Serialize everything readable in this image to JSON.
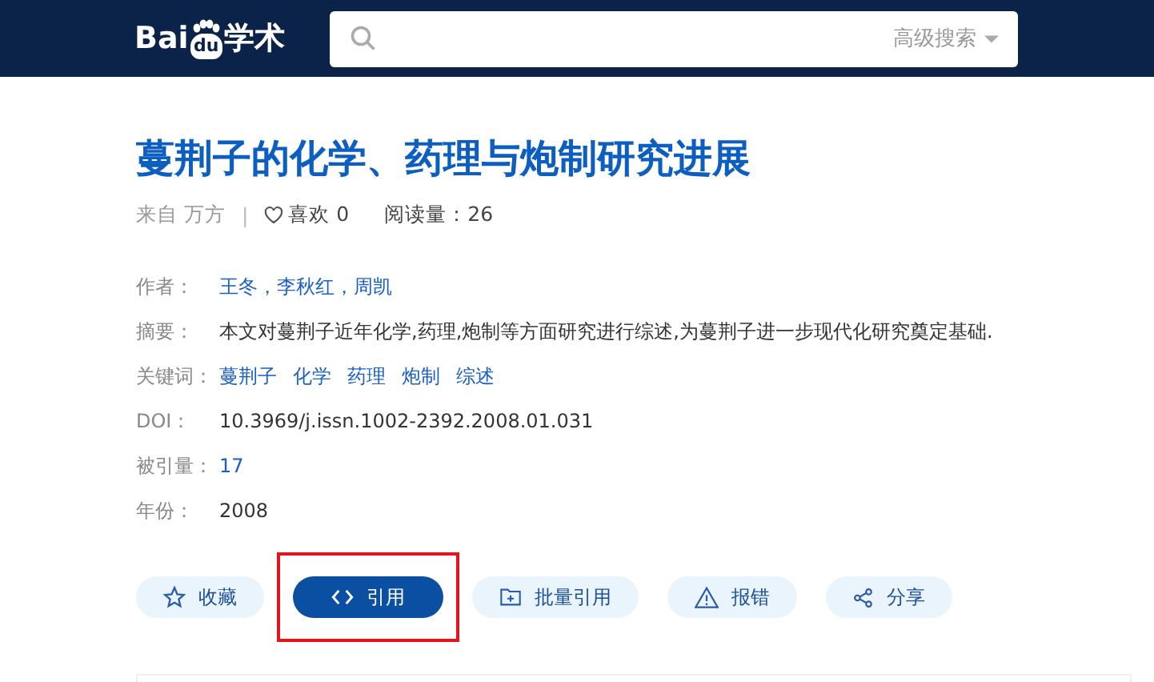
{
  "header": {
    "logo": {
      "left": "Bai",
      "mark": "du",
      "right": "学术"
    },
    "search": {
      "advanced": "高级搜索"
    }
  },
  "article": {
    "title": "蔓荆子的化学、药理与炮制研究进展",
    "meta": {
      "source": "来自 万方",
      "separator": "|",
      "likes": "喜欢 0",
      "reads": "阅读量：26"
    },
    "fields": [
      {
        "label": "作者：",
        "kind": "links",
        "values": [
          "王冬，李秋红，周凯"
        ]
      },
      {
        "label": "摘要：",
        "kind": "text",
        "values": [
          "本文对蔓荆子近年化学,药理,炮制等方面研究进行综述,为蔓荆子进一步现代化研究奠定基础."
        ]
      },
      {
        "label": "关键词：",
        "kind": "links",
        "values": [
          "蔓荆子",
          "化学",
          "药理",
          "炮制",
          "综述"
        ]
      },
      {
        "label": "DOI：",
        "kind": "text",
        "values": [
          "10.3969/j.issn.1002-2392.2008.01.031"
        ]
      },
      {
        "label": "被引量：",
        "kind": "links",
        "values": [
          "17"
        ]
      },
      {
        "label": "年份：",
        "kind": "text",
        "values": [
          "2008"
        ]
      }
    ],
    "actions": [
      {
        "label": "收藏",
        "kind": "star",
        "selected": false,
        "highlighted": false
      },
      {
        "label": "引用",
        "kind": "code",
        "selected": true,
        "highlighted": true
      },
      {
        "label": "批量引用",
        "kind": "folder",
        "selected": false,
        "highlighted": false
      },
      {
        "label": "报错",
        "kind": "warning",
        "selected": false,
        "highlighted": false
      },
      {
        "label": "分享",
        "kind": "share",
        "selected": false,
        "highlighted": false
      }
    ]
  }
}
